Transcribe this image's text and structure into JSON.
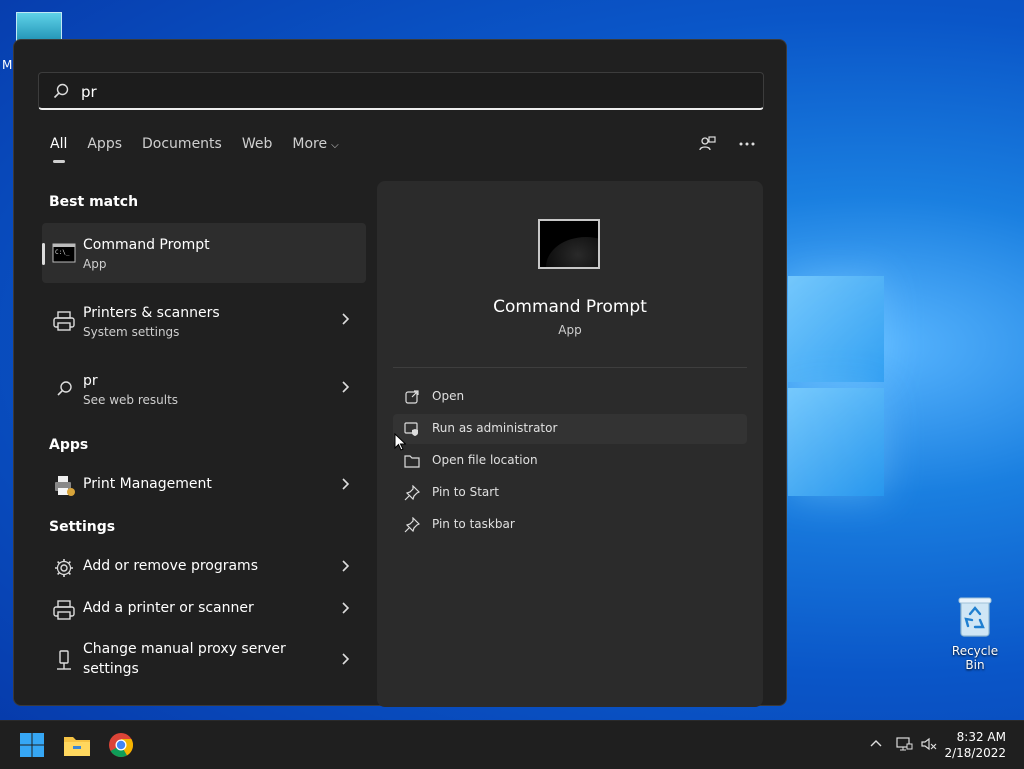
{
  "desktop": {
    "icons": [
      {
        "label": "M"
      },
      {
        "label": "Recycle Bin"
      }
    ]
  },
  "search": {
    "value": "pr"
  },
  "tabs": [
    {
      "label": "All",
      "active": true
    },
    {
      "label": "Apps"
    },
    {
      "label": "Documents"
    },
    {
      "label": "Web"
    },
    {
      "label": "More"
    }
  ],
  "sections": {
    "best_match": "Best match",
    "apps": "Apps",
    "settings": "Settings"
  },
  "results": {
    "best": {
      "title": "Command Prompt",
      "subtitle": "App"
    },
    "printers": {
      "title": "Printers & scanners",
      "subtitle": "System settings"
    },
    "web": {
      "title": "pr",
      "subtitle": "See web results"
    },
    "print_management": {
      "title": "Print Management"
    },
    "add_remove": {
      "title": "Add or remove programs"
    },
    "add_printer": {
      "title": "Add a printer or scanner"
    },
    "proxy": {
      "title_line1": "Change manual proxy server",
      "title_line2": "settings"
    }
  },
  "preview": {
    "title": "Command Prompt",
    "subtitle": "App",
    "actions": [
      {
        "label": "Open"
      },
      {
        "label": "Run as administrator"
      },
      {
        "label": "Open file location"
      },
      {
        "label": "Pin to Start"
      },
      {
        "label": "Pin to taskbar"
      }
    ]
  },
  "taskbar": {
    "time": "8:32 AM",
    "date": "2/18/2022"
  },
  "colors": {
    "panel_bg": "#202020",
    "preview_bg": "#2b2b2b",
    "taskbar_bg": "#1f1f1f",
    "accent": "#0a74da"
  }
}
